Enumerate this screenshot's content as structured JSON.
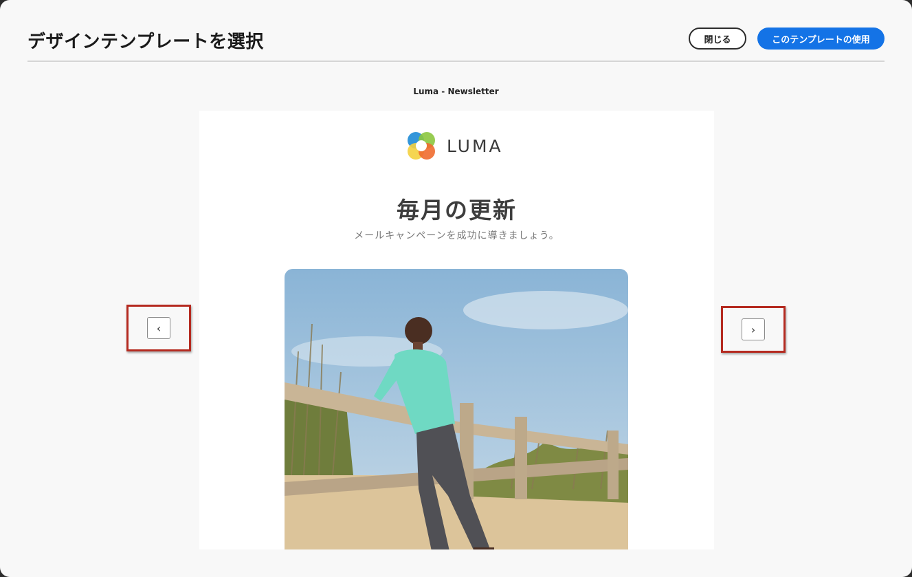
{
  "dialog": {
    "title": "デザインテンプレートを選択",
    "close_label": "閉じる",
    "use_label": "このテンプレートの使用"
  },
  "template": {
    "name": "Luma - Newsletter"
  },
  "preview": {
    "brand": "LUMA",
    "headline": "毎月の更新",
    "subline": "メールキャンペーンを成功に導きましょう。"
  },
  "nav": {
    "prev_glyph": "‹",
    "next_glyph": "›"
  },
  "colors": {
    "accent": "#1473e6",
    "highlight_frame": "#b52a20"
  },
  "icons": {
    "prev": "chevron-left-icon",
    "next": "chevron-right-icon",
    "logo": "luma-logo-icon"
  }
}
